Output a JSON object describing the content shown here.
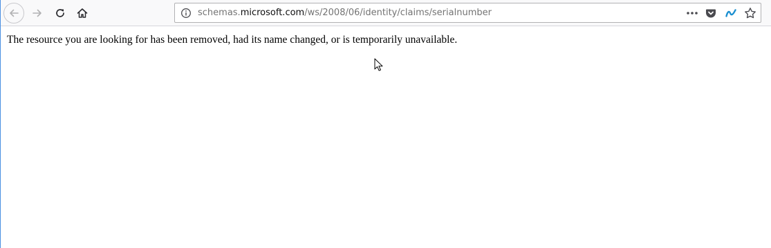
{
  "browser": {
    "address_bar": {
      "url_prefix": "schemas.",
      "url_host": "microsoft.com",
      "url_path": "/ws/2008/06/identity/claims/serialnumber"
    },
    "icons": {
      "back": "back-arrow-icon",
      "forward": "forward-arrow-icon",
      "reload": "reload-icon",
      "home": "home-icon",
      "site_info": "info-icon",
      "page_actions": "more-horizontal-icon",
      "pocket": "pocket-icon",
      "extension": "extension-icon",
      "bookmark": "star-icon"
    },
    "colors": {
      "accent": "#4a90e2",
      "toolbar_bg": "#f9f9fa",
      "url_muted": "#737373",
      "url_host": "#0c0c0d"
    }
  },
  "page": {
    "message": "The resource you are looking for has been removed, had its name changed, or is temporarily unavailable."
  }
}
